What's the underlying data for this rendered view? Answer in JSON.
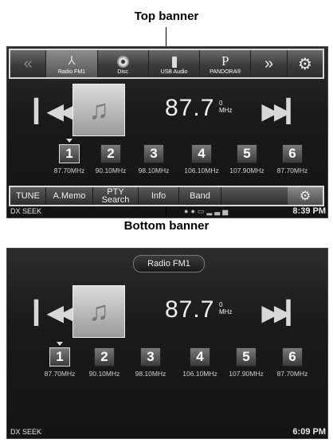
{
  "captions": {
    "top": "Top banner",
    "bottom": "Bottom banner"
  },
  "top_banner": {
    "items": [
      {
        "label": "Radio FM1",
        "icon": "antenna-icon"
      },
      {
        "label": "Disc",
        "icon": "disc-icon"
      },
      {
        "label": "USB Audio",
        "icon": "usb-icon"
      },
      {
        "label": "PANDORA®",
        "icon": "pandora-icon"
      }
    ]
  },
  "player": {
    "frequency": "87.7",
    "unit_top": "0",
    "unit_bottom": "MHz",
    "station_name": "Radio FM1"
  },
  "presets": [
    {
      "number": "1",
      "freq": "87.70MHz"
    },
    {
      "number": "2",
      "freq": "90.10MHz"
    },
    {
      "number": "3",
      "freq": "98.10MHz"
    },
    {
      "number": "4",
      "freq": "106.10MHz"
    },
    {
      "number": "5",
      "freq": "107.90MHz"
    },
    {
      "number": "6",
      "freq": "87.70MHz"
    }
  ],
  "bottom_banner": {
    "tune": "TUNE",
    "amemo": "A.Memo",
    "pty": "PTY Search",
    "info": "Info",
    "band": "Band"
  },
  "status1": {
    "mode": "DX SEEK",
    "time": "8:39 PM"
  },
  "status2": {
    "mode": "DX SEEK",
    "time": "6:09 PM"
  },
  "colors": {
    "screen_bg": "#1a1a1a",
    "banner_border": "#d8d8d8",
    "text": "#f0f0f0"
  }
}
